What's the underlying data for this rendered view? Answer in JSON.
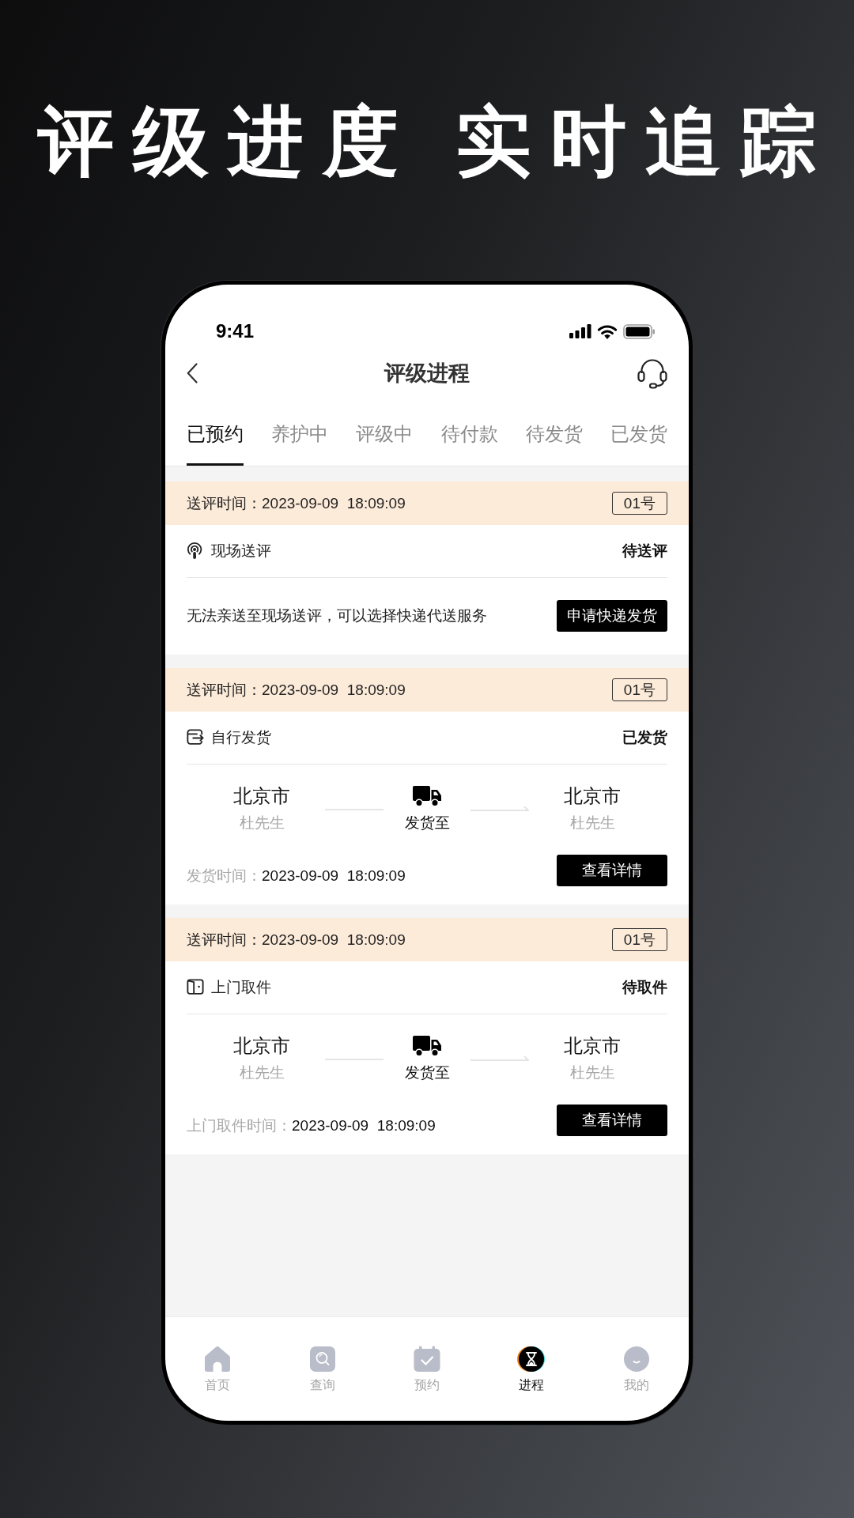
{
  "headline": "评级进度 实时追踪",
  "status_bar": {
    "time": "9:41"
  },
  "nav_bar": {
    "title": "评级进程"
  },
  "tabs": [
    {
      "label": "已预约",
      "selected": true
    },
    {
      "label": "养护中",
      "selected": false
    },
    {
      "label": "评级中",
      "selected": false
    },
    {
      "label": "待付款",
      "selected": false
    },
    {
      "label": "待发货",
      "selected": false
    },
    {
      "label": "已发货",
      "selected": false
    }
  ],
  "orders": [
    {
      "kind": "onsite",
      "submitted": "送评时间：2023-09-09  18:09:09",
      "number": "01号",
      "method": "现场送评",
      "status": "待送评",
      "note": "无法亲送至现场送评，可以选择快递代送服务",
      "action": "申请快递发货"
    },
    {
      "kind": "shipping",
      "submitted": "送评时间：2023-09-09  18:09:09",
      "number": "01号",
      "method": "自行发货",
      "status": "已发货",
      "route": {
        "from_city": "北京市",
        "from_name": "杜先生",
        "label": "发货至",
        "to_city": "北京市",
        "to_name": "杜先生"
      },
      "time_label": "发货时间：",
      "time": "2023-09-09  18:09:09",
      "action": "查看详情"
    },
    {
      "kind": "pickup",
      "submitted": "送评时间：2023-09-09  18:09:09",
      "number": "01号",
      "method": "上门取件",
      "status": "待取件",
      "route": {
        "from_city": "北京市",
        "from_name": "杜先生",
        "label": "发货至",
        "to_city": "北京市",
        "to_name": "杜先生"
      },
      "time_label": "上门取件时间：",
      "time": "2023-09-09  18:09:09",
      "action": "查看详情"
    }
  ],
  "bottom_nav": [
    {
      "kind": "home",
      "label": "首页",
      "selected": false
    },
    {
      "kind": "search",
      "label": "查询",
      "selected": false
    },
    {
      "kind": "calendar",
      "label": "预约",
      "selected": false
    },
    {
      "kind": "progress",
      "label": "进程",
      "selected": true
    },
    {
      "kind": "profile",
      "label": "我的",
      "selected": false
    }
  ]
}
